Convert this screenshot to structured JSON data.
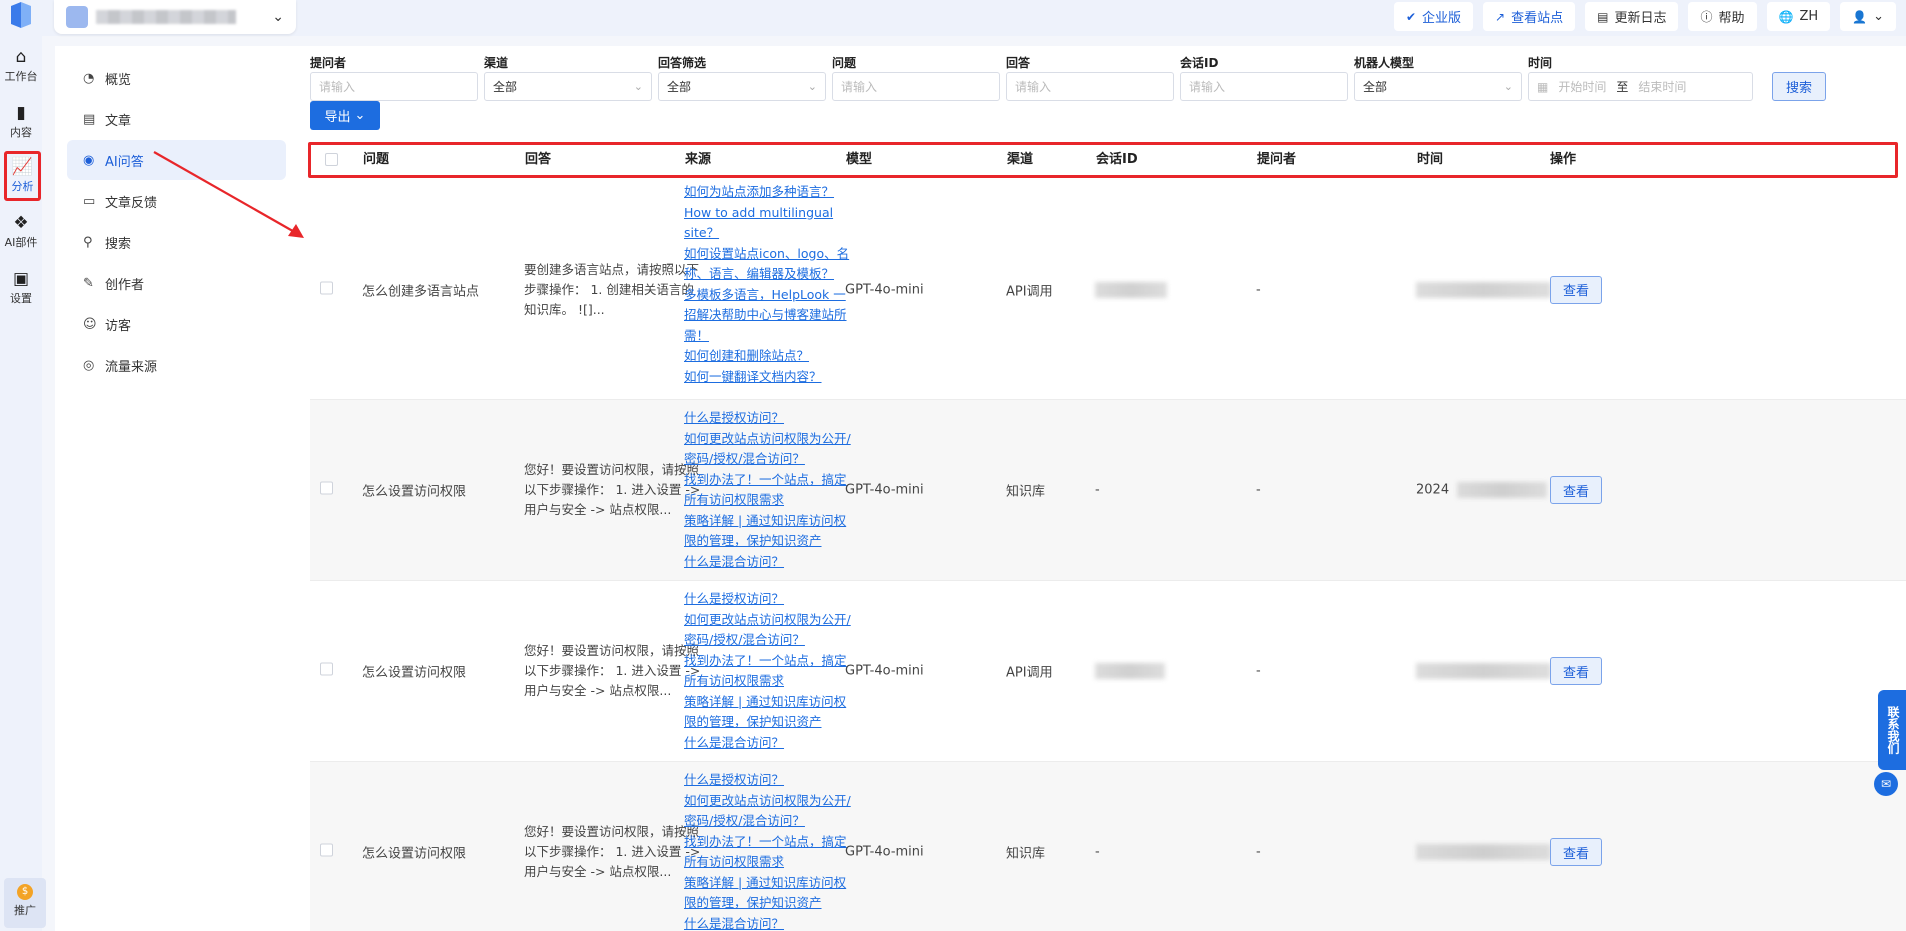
{
  "topbar": {
    "enterprise_label": "企业版",
    "view_site_label": "查看站点",
    "changelog_label": "更新日志",
    "help_label": "帮助",
    "lang_label": "ZH"
  },
  "rail": {
    "items": [
      {
        "label": "工作台",
        "icon": "home-icon"
      },
      {
        "label": "内容",
        "icon": "book-icon"
      },
      {
        "label": "分析",
        "icon": "chart-icon"
      },
      {
        "label": "AI部件",
        "icon": "widget-icon"
      },
      {
        "label": "设置",
        "icon": "monitor-icon"
      }
    ],
    "promo_label": "推广"
  },
  "subnav": {
    "items": [
      {
        "label": "概览"
      },
      {
        "label": "文章"
      },
      {
        "label": "AI问答"
      },
      {
        "label": "文章反馈"
      },
      {
        "label": "搜索"
      },
      {
        "label": "创作者"
      },
      {
        "label": "访客"
      },
      {
        "label": "流量来源"
      }
    ]
  },
  "filters": {
    "asker": {
      "label": "提问者",
      "placeholder": "请输入"
    },
    "channel": {
      "label": "渠道",
      "value": "全部"
    },
    "answer_filter": {
      "label": "回答筛选",
      "value": "全部"
    },
    "question": {
      "label": "问题",
      "placeholder": "请输入"
    },
    "answer": {
      "label": "回答",
      "placeholder": "请输入"
    },
    "session_id": {
      "label": "会话ID",
      "placeholder": "请输入"
    },
    "bot_model": {
      "label": "机器人模型",
      "value": "全部"
    },
    "time": {
      "label": "时间",
      "start": "开始时间",
      "sep": "至",
      "end": "结束时间"
    },
    "search_label": "搜索",
    "export_label": "导出"
  },
  "table": {
    "headers": {
      "question": "问题",
      "answer": "回答",
      "source": "来源",
      "model": "模型",
      "channel": "渠道",
      "session_id": "会话ID",
      "asker": "提问者",
      "time": "时间",
      "action": "操作"
    },
    "rows": [
      {
        "question": "怎么创建多语言站点",
        "answer": "要创建多语言站点，请按照以下步骤操作： 1. 创建相关语言的知识库。 ![]...",
        "sources": [
          "如何为站点添加多种语言？",
          "How to add multilingual",
          "site？",
          "如何设置站点icon、logo、名",
          "称、语言、编辑器及模板？",
          "多模板多语言，HelpLook 一",
          "招解决帮助中心与博客建站所",
          "需！",
          "如何创建和删除站点？",
          "如何一键翻译文档内容？"
        ],
        "model": "GPT-4o-mini",
        "channel": "API调用",
        "session_id": "",
        "asker": "-",
        "time": "",
        "action": "查看"
      },
      {
        "question": "怎么设置访问权限",
        "answer": "您好！要设置访问权限，请按照以下步骤操作： 1. 进入设置 -> 用户与安全 -> 站点权限...",
        "sources": [
          "什么是授权访问？",
          "如何更改站点访问权限为公开/",
          "密码/授权/混合访问？",
          "找到办法了！一个站点，搞定",
          "所有访问权限需求",
          "策略详解 | 通过知识库访问权",
          "限的管理，保护知识资产",
          "什么是混合访问？"
        ],
        "model": "GPT-4o-mini",
        "channel": "知识库",
        "session_id": "-",
        "asker": "-",
        "time": "2024",
        "action": "查看"
      },
      {
        "question": "怎么设置访问权限",
        "answer": "您好！要设置访问权限，请按照以下步骤操作： 1. 进入设置 -> 用户与安全 -> 站点权限...",
        "sources": [
          "什么是授权访问？",
          "如何更改站点访问权限为公开/",
          "密码/授权/混合访问？",
          "找到办法了！一个站点，搞定",
          "所有访问权限需求",
          "策略详解 | 通过知识库访问权",
          "限的管理，保护知识资产",
          "什么是混合访问？"
        ],
        "model": "GPT-4o-mini",
        "channel": "API调用",
        "session_id": "",
        "asker": "-",
        "time": "",
        "action": "查看"
      },
      {
        "question": "怎么设置访问权限",
        "answer": "您好！要设置访问权限，请按照以下步骤操作： 1. 进入设置 -> 用户与安全 -> 站点权限...",
        "sources": [
          "什么是授权访问？",
          "如何更改站点访问权限为公开/",
          "密码/授权/混合访问？",
          "找到办法了！一个站点，搞定",
          "所有访问权限需求",
          "策略详解 | 通过知识库访问权",
          "限的管理，保护知识资产",
          "什么是混合访问？"
        ],
        "model": "GPT-4o-mini",
        "channel": "知识库",
        "session_id": "-",
        "asker": "-",
        "time": "",
        "action": "查看"
      }
    ]
  },
  "contact": {
    "label": "联系我们"
  },
  "colors": {
    "accent": "#1d6de0",
    "highlight": "#e8262a"
  }
}
